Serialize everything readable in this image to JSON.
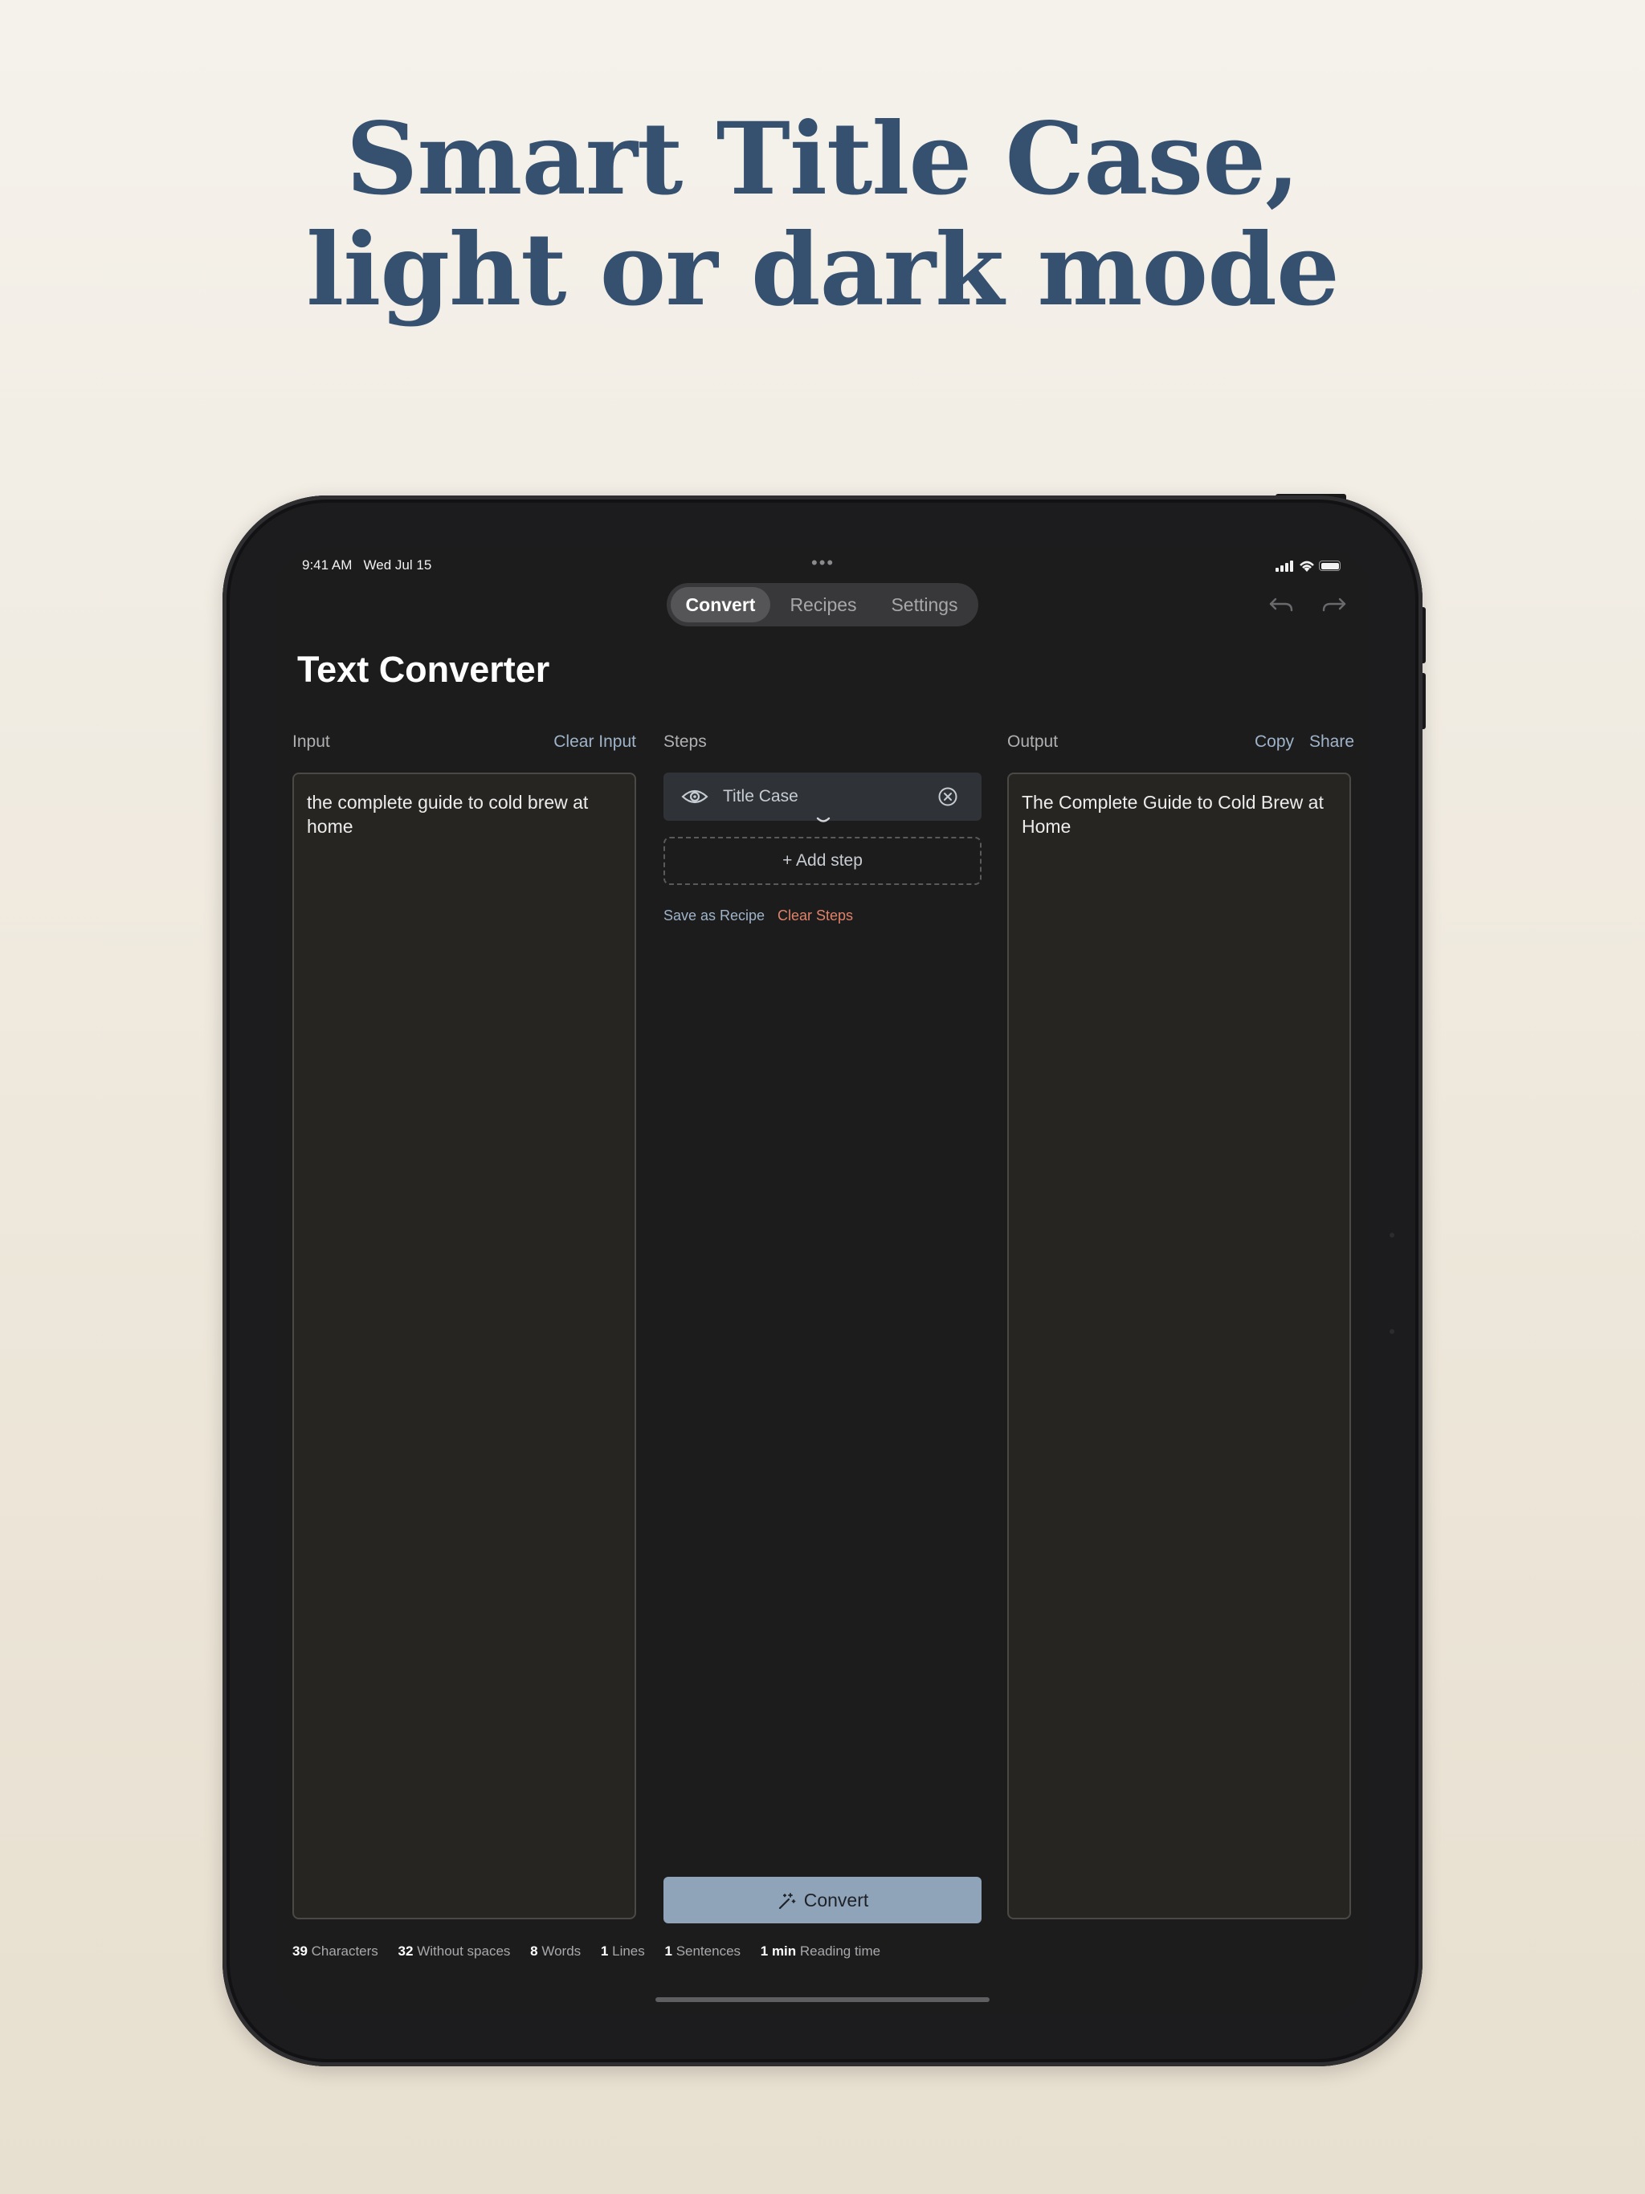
{
  "headline": {
    "line1": "Smart Title Case,",
    "line2": "light or dark mode"
  },
  "status_bar": {
    "time": "9:41 AM",
    "date": "Wed Jul 15",
    "dots": "•••"
  },
  "tabs": [
    {
      "label": "Convert",
      "active": true
    },
    {
      "label": "Recipes",
      "active": false
    },
    {
      "label": "Settings",
      "active": false
    }
  ],
  "toolbar": {
    "undo_icon": "undo-arrow-icon",
    "redo_icon": "redo-arrow-icon"
  },
  "page_title": "Text Converter",
  "input": {
    "label": "Input",
    "clear_label": "Clear Input",
    "text": "the complete guide to cold brew at home"
  },
  "steps": {
    "label": "Steps",
    "items": [
      {
        "label": "Title Case",
        "icon": "eye-icon",
        "remove_icon": "remove-circle-icon"
      }
    ],
    "add_step_label": "+ Add step",
    "save_recipe_label": "Save as Recipe",
    "clear_steps_label": "Clear Steps",
    "convert_label": "Convert"
  },
  "output": {
    "label": "Output",
    "copy_label": "Copy",
    "share_label": "Share",
    "text": "The Complete Guide to Cold Brew at Home"
  },
  "stats": [
    {
      "value": "39",
      "label": "Characters"
    },
    {
      "value": "32",
      "label": "Without spaces"
    },
    {
      "value": "8",
      "label": "Words"
    },
    {
      "value": "1",
      "label": "Lines"
    },
    {
      "value": "1",
      "label": "Sentences"
    },
    {
      "value": "1 min",
      "label": "Reading time"
    }
  ],
  "colors": {
    "headline": "#36516f",
    "accent_link": "#9fb3c9",
    "destructive": "#e0826a",
    "convert_button": "#8fa3b9"
  }
}
